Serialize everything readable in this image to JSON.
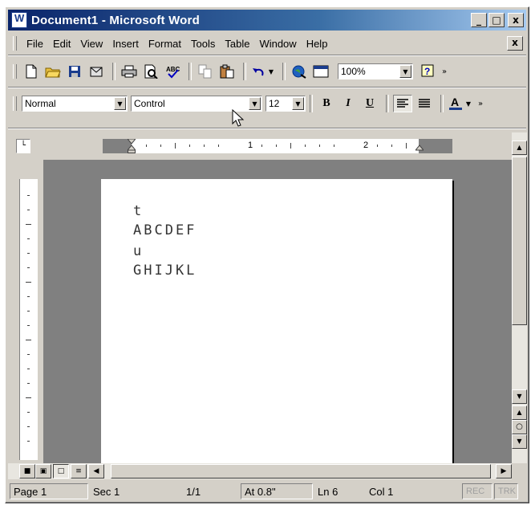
{
  "window": {
    "title": "Document1 - Microsoft Word"
  },
  "title_controls": {
    "minimize": "_",
    "maximize": "□",
    "close": "x"
  },
  "menubar": {
    "items": [
      "File",
      "Edit",
      "View",
      "Insert",
      "Format",
      "Tools",
      "Table",
      "Window",
      "Help"
    ],
    "doc_close": "x"
  },
  "standard_toolbar": {
    "zoom": "100%"
  },
  "formatting_toolbar": {
    "style": "Normal",
    "font": "Control",
    "size": "12",
    "bold": "B",
    "italic": "I",
    "underline": "U"
  },
  "ruler": {
    "marks": [
      "1",
      "2"
    ]
  },
  "document": {
    "lines": [
      "t",
      "ABCDEF",
      "u",
      "GHIJKL"
    ]
  },
  "statusbar": {
    "page": "Page 1",
    "section": "Sec 1",
    "pages": "1/1",
    "at": "At 0.8\"",
    "line": "Ln 6",
    "col": "Col 1",
    "rec": "REC",
    "trk": "TRK"
  },
  "colors": {
    "titlebar_start": "#0a246a",
    "titlebar_end": "#a6caf0",
    "chrome": "#d4d0c8"
  }
}
